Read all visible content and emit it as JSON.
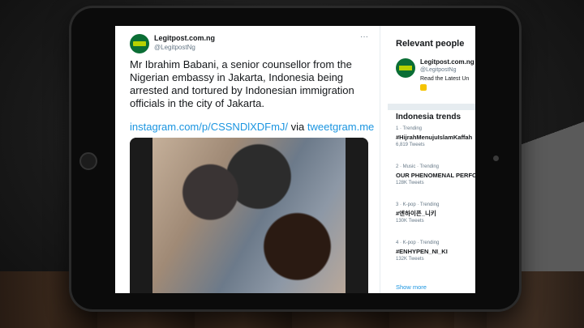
{
  "tweet": {
    "author_name": "Legitpost.com.ng",
    "author_handle": "@LegitpostNg",
    "more_icon": "ellipsis-icon",
    "text": "Mr Ibrahim Babani, a senior counsellor from the Nigerian embassy in Jakarta, Indonesia being arrested and tortured by Indonesian immigration officials in the city of Jakarta.",
    "link_text": "instagram.com/p/CSSNDlXDFmJ/",
    "via_text": "via",
    "via_link": "tweetgram.me"
  },
  "sidebar": {
    "relevant_title": "Relevant people",
    "person": {
      "name": "Legitpost.com.ng",
      "handle": "@LegitpostNg",
      "bio": "Read the Latest Un"
    },
    "trends_title": "Indonesia trends",
    "trends": [
      {
        "meta": "1 · Trending",
        "tag": "#HijrahMenujuIslamKaffah",
        "count": "6,819 Tweets"
      },
      {
        "meta": "2 · Music · Trending",
        "tag": "OUR PHENOMENAL PERFO",
        "count": "128K Tweets"
      },
      {
        "meta": "3 · K-pop · Trending",
        "tag": "#엔하이픈_니키",
        "count": "130K Tweets"
      },
      {
        "meta": "4 · K-pop · Trending",
        "tag": "#ENHYPEN_NI_KI",
        "count": "132K Tweets"
      }
    ],
    "show_more": "Show more"
  },
  "colors": {
    "link": "#1b95e0",
    "brand_green": "#0b6e35",
    "brand_lime": "#b7d200"
  }
}
